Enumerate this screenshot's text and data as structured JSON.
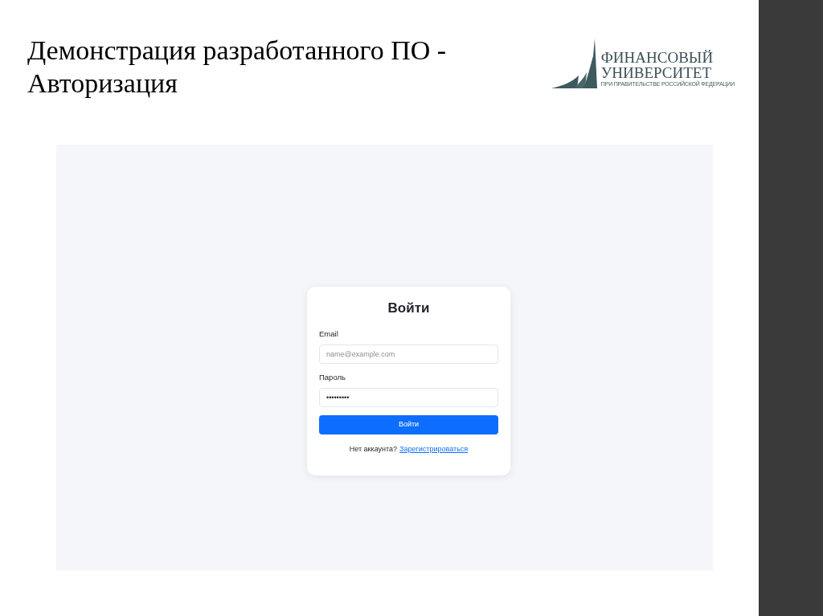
{
  "slide": {
    "title": "Демонстрация разработанного ПО - Авторизация",
    "logo": {
      "name_lines": [
        "ФИНАНСОВЫЙ",
        "УНИВЕРСИТЕТ"
      ],
      "subtitle": "ПРИ ПРАВИТЕЛЬСТВЕ РОССИЙСКОЙ ФЕДЕРАЦИИ"
    }
  },
  "screenshot": {
    "login_form": {
      "title": "Войти",
      "fields": [
        {
          "label": "Email",
          "placeholder": "name@example.com"
        },
        {
          "label": "Пароль",
          "value": "•••••••••"
        }
      ],
      "submit_button": "Войти",
      "footer": {
        "text": "Нет аккаунта?",
        "link": "Зарегистрироваться"
      }
    }
  }
}
